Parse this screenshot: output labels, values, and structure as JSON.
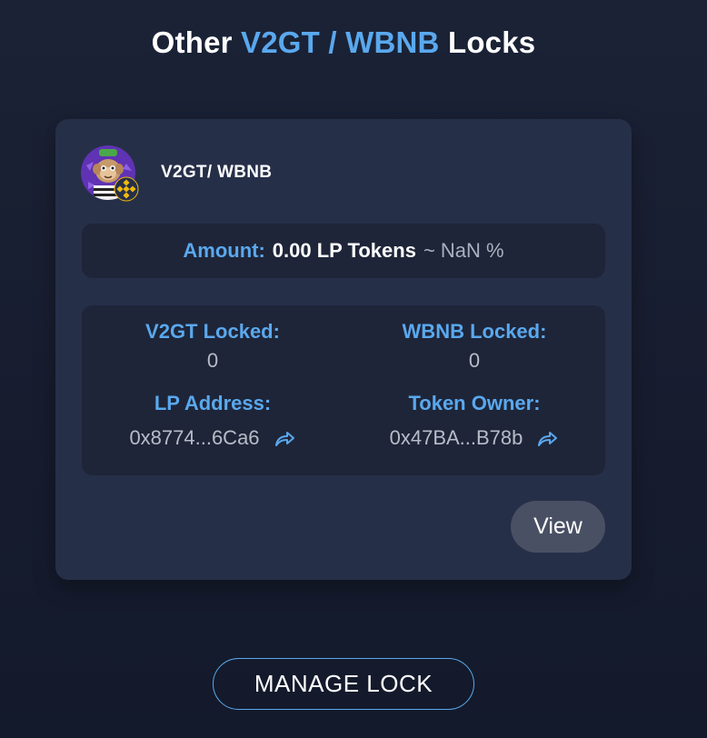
{
  "title": {
    "prefix": "Other",
    "pair": "V2GT / WBNB",
    "suffix": "Locks"
  },
  "card": {
    "pair_name": "V2GT/ WBNB",
    "amount": {
      "label": "Amount:",
      "value": "0.00 LP Tokens",
      "percent": "~ NaN %"
    },
    "details": {
      "token0_locked_label": "V2GT Locked:",
      "token0_locked_value": "0",
      "token1_locked_label": "WBNB Locked:",
      "token1_locked_value": "0",
      "lp_address_label": "LP Address:",
      "lp_address_value": "0x8774...6Ca6",
      "token_owner_label": "Token Owner:",
      "token_owner_value": "0x47BA...B78b"
    },
    "view_label": "View"
  },
  "manage_lock_label": "MANAGE LOCK",
  "colors": {
    "accent": "#5aa8ee",
    "card_bg": "#262f48",
    "inner_box_bg": "#1e2538",
    "button_bg": "#4a5064"
  },
  "icons": {
    "share": "share-arrow-icon",
    "token0": "monkey-token-icon",
    "token1": "bnb-icon"
  }
}
